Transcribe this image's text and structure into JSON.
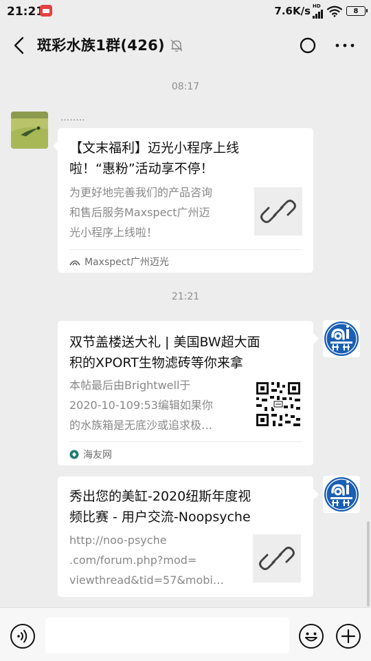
{
  "status_bar": {
    "time": "21:21",
    "net_speed": "7.6K/s",
    "hd_label": "HD",
    "battery": "8",
    "icons": [
      "notification-app-icon",
      "hd-signal-icon",
      "wifi-icon",
      "battery-icon"
    ]
  },
  "header": {
    "title": "斑彩水族1群(426)",
    "icons": [
      "back-arrow-icon",
      "mute-bell-icon",
      "mini-program-circle-icon",
      "more-dots-icon"
    ]
  },
  "messages": [
    {
      "timestamp": "08:17",
      "sender_nick": "........",
      "side": "left",
      "card": {
        "title": "【文末福利】迈光小程序上线啦！“惠粉”活动享不停！",
        "title_lines": [
          "【文末福利】迈光小程序上线",
          "啦！“惠粉”活动享不停！"
        ],
        "desc_lines": [
          "为更好地完善我们的产品咨询",
          "和售后服务Maxspect广州迈",
          "光小程序上线啦！"
        ],
        "thumb": "link-icon",
        "source": "Maxspect广州迈光",
        "source_icon": "source-logo-icon"
      }
    },
    {
      "timestamp": "21:21",
      "side": "right",
      "card": {
        "title_lines": [
          "双节盖楼送大礼 | 美国BW超大面",
          "积的XPORT生物滤砖等你来拿"
        ],
        "desc_lines": [
          "本帖最后由Brightwell于",
          "2020-10-109:53编辑如果你",
          "的水族箱是无底沙或追求极…"
        ],
        "thumb": "qr-code",
        "source": "海友网",
        "source_icon": "source-logo-icon"
      }
    },
    {
      "side": "right",
      "card": {
        "title_lines": [
          "秀出您的美缸-2020纽斯年度视",
          "频比赛 - 用户交流-Noopsyche"
        ],
        "desc_lines": [
          "http://noo-psyche",
          ".com/forum.php?mod=",
          "viewthread&tid=57&mobi…"
        ],
        "thumb": "link-icon"
      }
    }
  ],
  "input_bar": {
    "value": "",
    "icons": [
      "voice-icon",
      "emoji-icon",
      "plus-icon"
    ]
  },
  "colors": {
    "background": "#ededed",
    "card": "#ffffff",
    "avatar_blue": "#1a5fb4",
    "text_primary": "#111111",
    "text_secondary": "#888888"
  }
}
